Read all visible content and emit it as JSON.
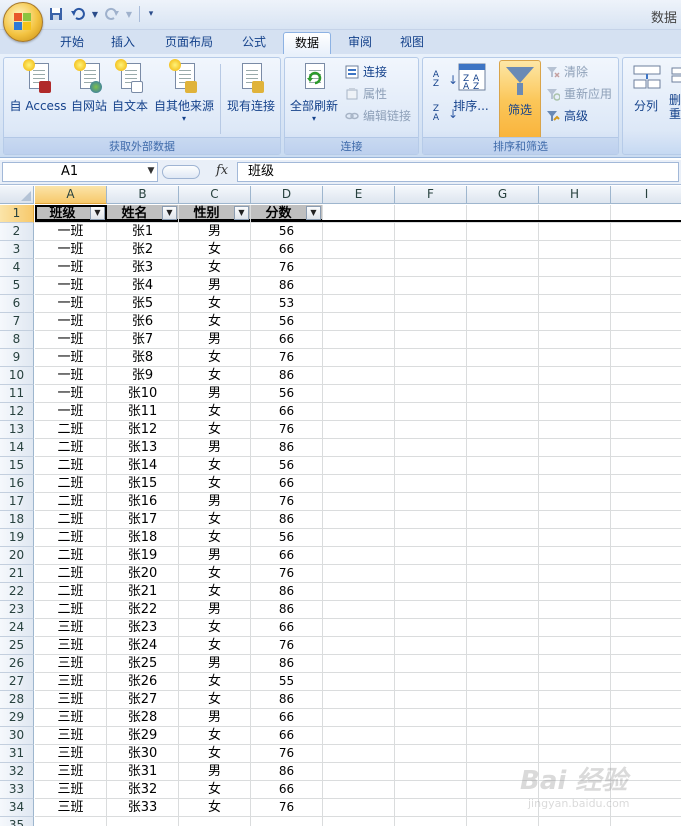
{
  "window": {
    "title": "数据"
  },
  "qat": {
    "save_icon": "save-icon",
    "undo_icon": "undo-icon",
    "redo_icon": "redo-icon"
  },
  "tabs": [
    {
      "label": "开始",
      "active": false
    },
    {
      "label": "插入",
      "active": false
    },
    {
      "label": "页面布局",
      "active": false
    },
    {
      "label": "公式",
      "active": false
    },
    {
      "label": "数据",
      "active": true
    },
    {
      "label": "审阅",
      "active": false
    },
    {
      "label": "视图",
      "active": false
    }
  ],
  "ribbon": {
    "external": {
      "label": "获取外部数据",
      "access": "自 Access",
      "web": "自网站",
      "text": "自文本",
      "other": "自其他来源",
      "existing": "现有连接"
    },
    "connections": {
      "label": "连接",
      "refresh_all": "全部刷新",
      "connections": "连接",
      "properties": "属性",
      "edit_links": "编辑链接"
    },
    "sort_filter": {
      "label": "排序和筛选",
      "sort": "排序...",
      "filter": "筛选",
      "clear": "清除",
      "reapply": "重新应用",
      "advanced": "高级"
    },
    "data_tools": {
      "text_to_columns": "分列",
      "remove_partial": "删",
      "remove_partial2": "重"
    }
  },
  "formula_bar": {
    "cell_ref": "A1",
    "fx_label": "fx",
    "value": "班级"
  },
  "columns": [
    "A",
    "B",
    "C",
    "D",
    "E",
    "F",
    "G",
    "H",
    "I"
  ],
  "header_row": [
    "班级",
    "姓名",
    "性别",
    "分数"
  ],
  "rows": [
    [
      "一班",
      "张1",
      "男",
      "56"
    ],
    [
      "一班",
      "张2",
      "女",
      "66"
    ],
    [
      "一班",
      "张3",
      "女",
      "76"
    ],
    [
      "一班",
      "张4",
      "男",
      "86"
    ],
    [
      "一班",
      "张5",
      "女",
      "53"
    ],
    [
      "一班",
      "张6",
      "女",
      "56"
    ],
    [
      "一班",
      "张7",
      "男",
      "66"
    ],
    [
      "一班",
      "张8",
      "女",
      "76"
    ],
    [
      "一班",
      "张9",
      "女",
      "86"
    ],
    [
      "一班",
      "张10",
      "男",
      "56"
    ],
    [
      "一班",
      "张11",
      "女",
      "66"
    ],
    [
      "二班",
      "张12",
      "女",
      "76"
    ],
    [
      "二班",
      "张13",
      "男",
      "86"
    ],
    [
      "二班",
      "张14",
      "女",
      "56"
    ],
    [
      "二班",
      "张15",
      "女",
      "66"
    ],
    [
      "二班",
      "张16",
      "男",
      "76"
    ],
    [
      "二班",
      "张17",
      "女",
      "86"
    ],
    [
      "二班",
      "张18",
      "女",
      "56"
    ],
    [
      "二班",
      "张19",
      "男",
      "66"
    ],
    [
      "二班",
      "张20",
      "女",
      "76"
    ],
    [
      "二班",
      "张21",
      "女",
      "86"
    ],
    [
      "二班",
      "张22",
      "男",
      "86"
    ],
    [
      "三班",
      "张23",
      "女",
      "66"
    ],
    [
      "三班",
      "张24",
      "女",
      "76"
    ],
    [
      "三班",
      "张25",
      "男",
      "86"
    ],
    [
      "三班",
      "张26",
      "女",
      "55"
    ],
    [
      "三班",
      "张27",
      "女",
      "86"
    ],
    [
      "三班",
      "张28",
      "男",
      "66"
    ],
    [
      "三班",
      "张29",
      "女",
      "66"
    ],
    [
      "三班",
      "张30",
      "女",
      "76"
    ],
    [
      "三班",
      "张31",
      "男",
      "86"
    ],
    [
      "三班",
      "张32",
      "女",
      "66"
    ],
    [
      "三班",
      "张33",
      "女",
      "76"
    ]
  ],
  "row_numbers": [
    "1",
    "2",
    "3",
    "4",
    "5",
    "6",
    "7",
    "8",
    "9",
    "10",
    "11",
    "12",
    "13",
    "14",
    "15",
    "16",
    "17",
    "18",
    "19",
    "20",
    "21",
    "22",
    "23",
    "24",
    "25",
    "26",
    "27",
    "28",
    "29",
    "30",
    "31",
    "32",
    "33",
    "34",
    "35"
  ],
  "watermark": {
    "text": "Bai 经验",
    "sub": "jingyan.baidu.com"
  }
}
